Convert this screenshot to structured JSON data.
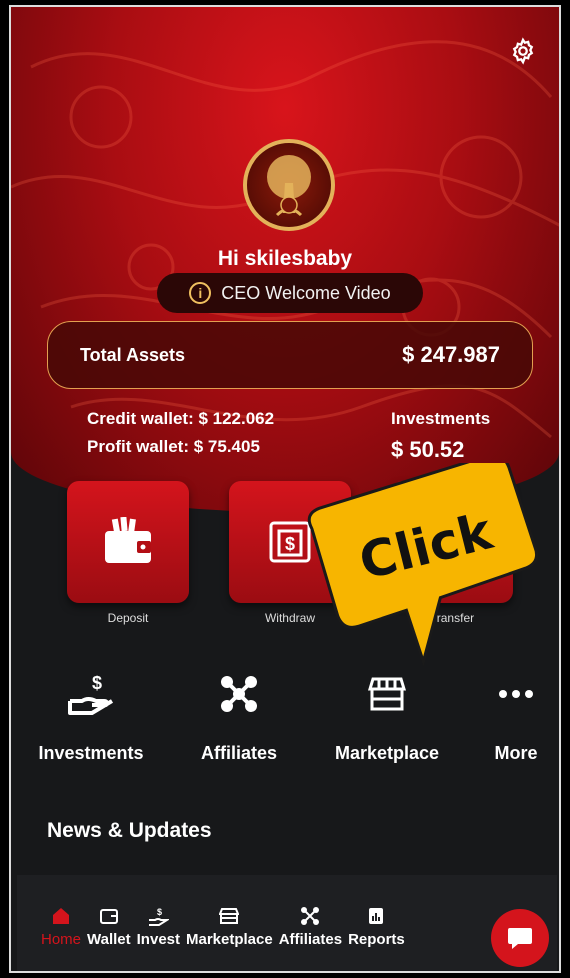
{
  "header": {
    "settings_icon": "gear-icon",
    "greeting": "Hi skilesbaby"
  },
  "ceo_video": {
    "label": "CEO Welcome Video",
    "icon": "info-icon"
  },
  "total_assets": {
    "label": "Total Assets",
    "value": "$ 247.987"
  },
  "wallets": {
    "credit": "Credit wallet: $ 122.062",
    "profit": "Profit wallet: $ 75.405"
  },
  "investments": {
    "label": "Investments",
    "value": "$ 50.52"
  },
  "actions": [
    {
      "label": "Deposit",
      "icon": "wallet-icon"
    },
    {
      "label": "Withdraw",
      "icon": "withdraw-icon"
    },
    {
      "label": "Transfer",
      "icon": "transfer-icon"
    }
  ],
  "callout": {
    "text": "Click",
    "color": "#f7b500"
  },
  "menu": [
    {
      "label": "Investments",
      "icon": "hand-dollar-icon"
    },
    {
      "label": "Affiliates",
      "icon": "network-icon"
    },
    {
      "label": "Marketplace",
      "icon": "store-icon"
    },
    {
      "label": "More",
      "icon": "more-icon"
    }
  ],
  "news_title": "News & Updates",
  "bottom_nav": [
    {
      "label": "Home",
      "icon": "home-icon",
      "active": true
    },
    {
      "label": "Wallet",
      "icon": "wallet-icon"
    },
    {
      "label": "Invest",
      "icon": "hand-dollar-icon"
    },
    {
      "label": "Marketplace",
      "icon": "store-icon"
    },
    {
      "label": "Affiliates",
      "icon": "network-icon"
    },
    {
      "label": "Reports",
      "icon": "report-icon"
    }
  ],
  "colors": {
    "brand_red": "#d4141c",
    "gold": "#e3b25a",
    "background": "#17181a"
  }
}
